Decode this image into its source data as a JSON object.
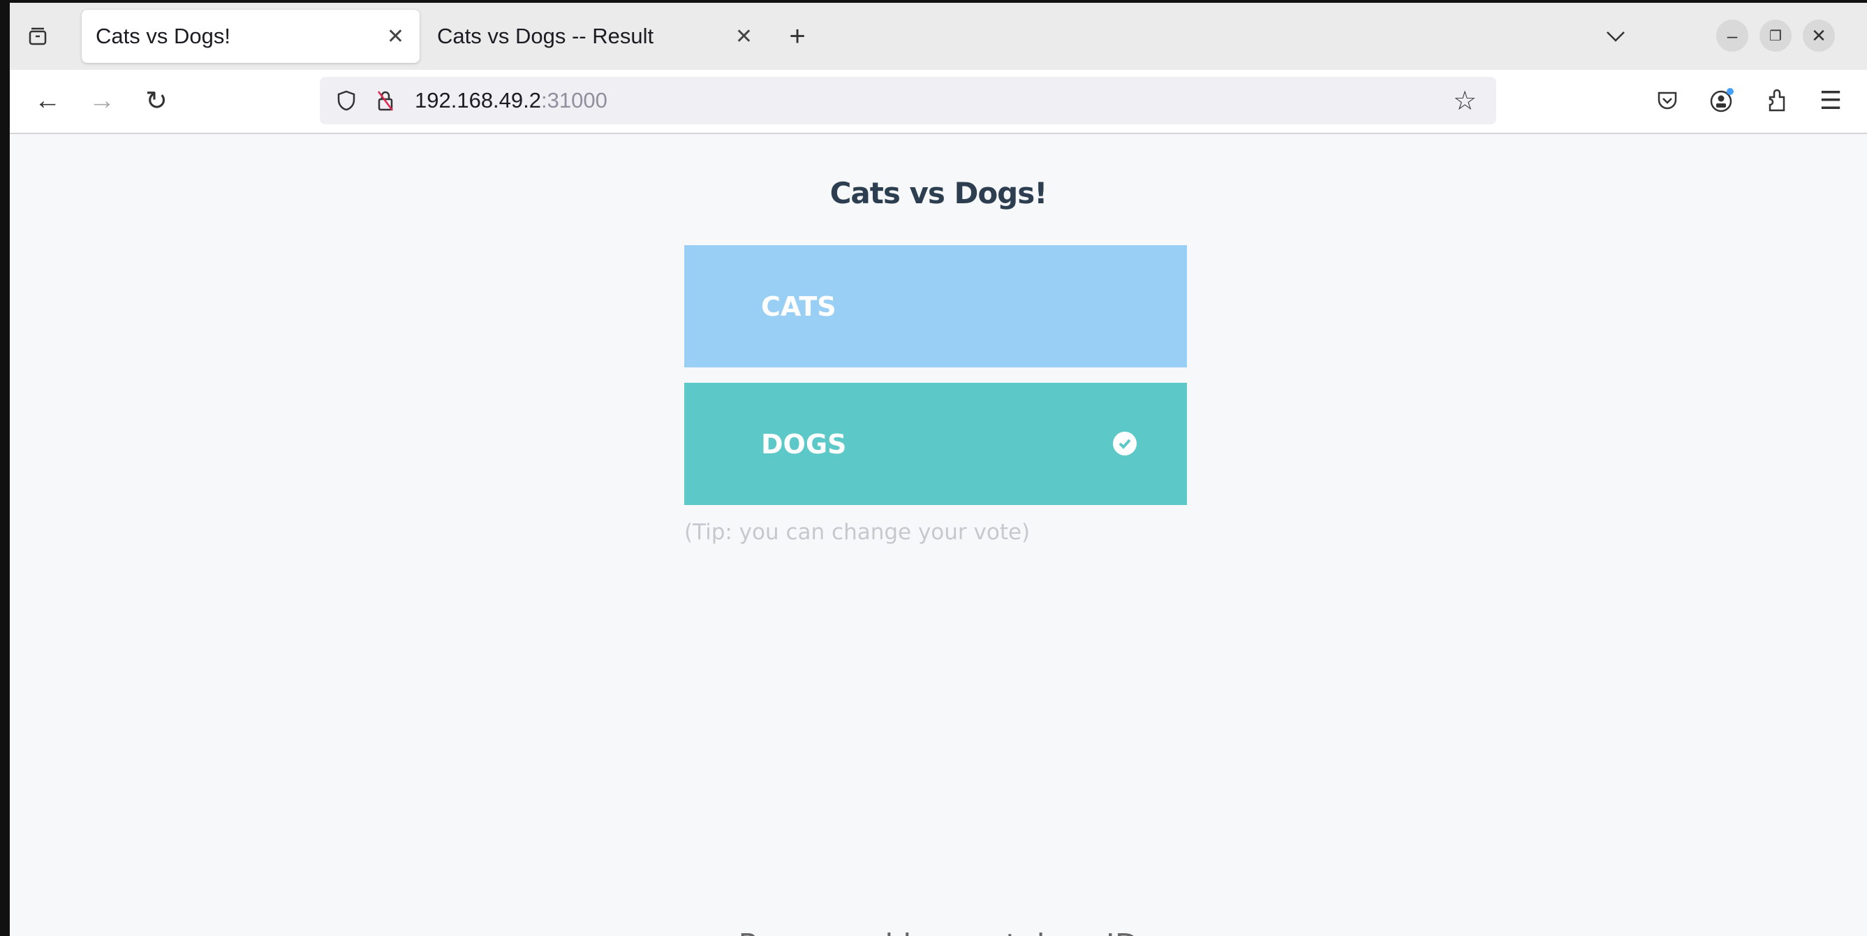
{
  "browser": {
    "tabs": [
      {
        "label": "Cats vs Dogs!",
        "active": true
      },
      {
        "label": "Cats vs Dogs -- Result",
        "active": false
      }
    ],
    "url_host": "192.168.49.2",
    "url_port": ":31000"
  },
  "page": {
    "title": "Cats vs Dogs!",
    "options": [
      {
        "label": "CATS",
        "selected": false,
        "color": "#9acff5"
      },
      {
        "label": "DOGS",
        "selected": true,
        "color": "#5dc8c8"
      }
    ],
    "tip": "(Tip: you can change your vote)",
    "footer": "Processed by container ID"
  }
}
